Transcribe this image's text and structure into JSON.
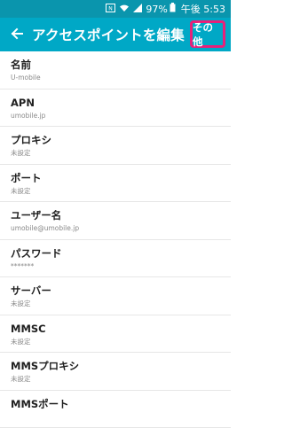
{
  "status_bar": {
    "battery_percent": "97%",
    "time": "午後 5:53",
    "icons": [
      "nfc-icon",
      "wifi-icon",
      "signal-icon",
      "battery-icon"
    ]
  },
  "app_bar": {
    "title": "アクセスポイントを編集",
    "more_label": "その他",
    "accent_color": "#00a8c6",
    "highlight_color": "#e8207a"
  },
  "settings": [
    {
      "label": "名前",
      "value": "U-mobile"
    },
    {
      "label": "APN",
      "value": "umobile.jp"
    },
    {
      "label": "プロキシ",
      "value": "未設定"
    },
    {
      "label": "ポート",
      "value": "未設定"
    },
    {
      "label": "ユーザー名",
      "value": "umobile@umobile.jp"
    },
    {
      "label": "パスワード",
      "value": "*******"
    },
    {
      "label": "サーバー",
      "value": "未設定"
    },
    {
      "label": "MMSC",
      "value": "未設定"
    },
    {
      "label": "MMSプロキシ",
      "value": "未設定"
    },
    {
      "label": "MMSポート",
      "value": ""
    }
  ]
}
